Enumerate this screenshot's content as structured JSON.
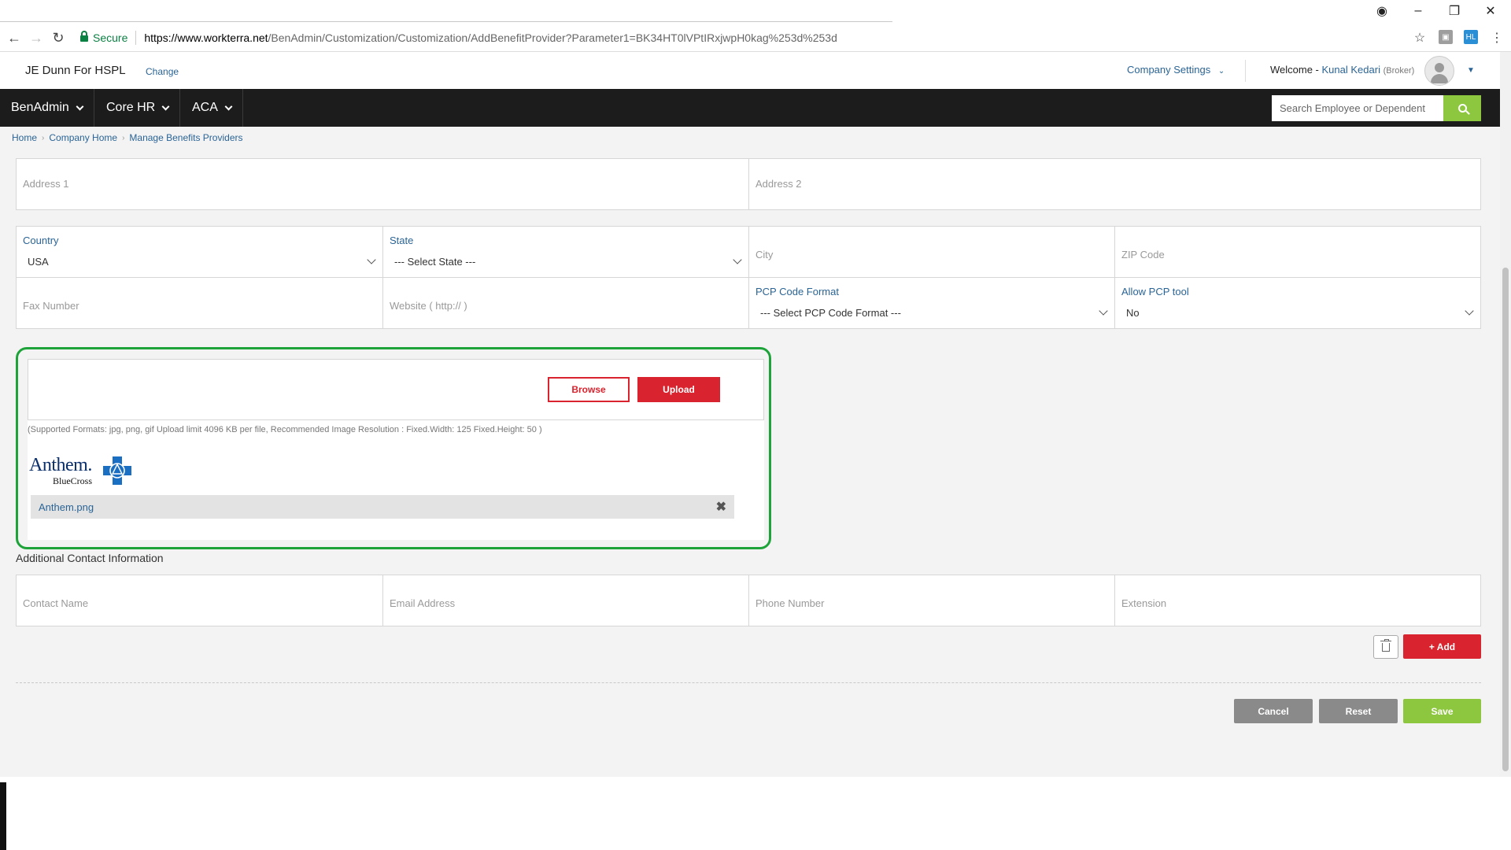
{
  "browser": {
    "secure_label": "Secure",
    "url_host": "https://www.workterra.net",
    "url_path": "/BenAdmin/Customization/Customization/AddBenefitProvider?Parameter1=BK34HT0lVPtIRxjwpH0kag%253d%253d"
  },
  "header": {
    "company_name": "JE Dunn For HSPL",
    "change_label": "Change",
    "company_settings_label": "Company Settings",
    "welcome_label": "Welcome -",
    "user_name": "Kunal Kedari",
    "user_role": "(Broker)"
  },
  "nav": {
    "items": [
      {
        "label": "BenAdmin"
      },
      {
        "label": "Core HR"
      },
      {
        "label": "ACA"
      }
    ],
    "search_placeholder": "Search Employee or Dependent"
  },
  "breadcrumb": [
    "Home",
    "Company Home",
    "Manage Benefits Providers"
  ],
  "form": {
    "address1_placeholder": "Address 1",
    "address2_placeholder": "Address 2",
    "country_label": "Country",
    "country_value": "USA",
    "state_label": "State",
    "state_value": "--- Select State ---",
    "city_placeholder": "City",
    "zip_placeholder": "ZIP Code",
    "fax_placeholder": "Fax Number",
    "website_placeholder": "Website ( http:// )",
    "pcp_format_label": "PCP Code Format",
    "pcp_format_value": "--- Select PCP Code Format ---",
    "allow_pcp_label": "Allow PCP tool",
    "allow_pcp_value": "No"
  },
  "upload": {
    "browse_label": "Browse",
    "upload_label": "Upload",
    "formats_note": "(Supported Formats: jpg, png, gif Upload limit 4096 KB per file, Recommended Image Resolution : Fixed.Width: 125 Fixed.Height: 50 )",
    "logo_word": "Anthem.",
    "logo_sub": "BlueCross",
    "file_name": "Anthem.png",
    "remove_glyph": "✖"
  },
  "contact": {
    "heading": "Additional Contact Information",
    "name_placeholder": "Contact Name",
    "email_placeholder": "Email Address",
    "phone_placeholder": "Phone Number",
    "extension_placeholder": "Extension",
    "add_label": "+ Add"
  },
  "actions": {
    "cancel_label": "Cancel",
    "reset_label": "Reset",
    "save_label": "Save"
  },
  "colors": {
    "accent_red": "#d9232e",
    "accent_green": "#8dc63f",
    "highlight_green": "#1ea33a",
    "link_blue": "#2a6496",
    "nav_bg": "#1c1c1c"
  }
}
